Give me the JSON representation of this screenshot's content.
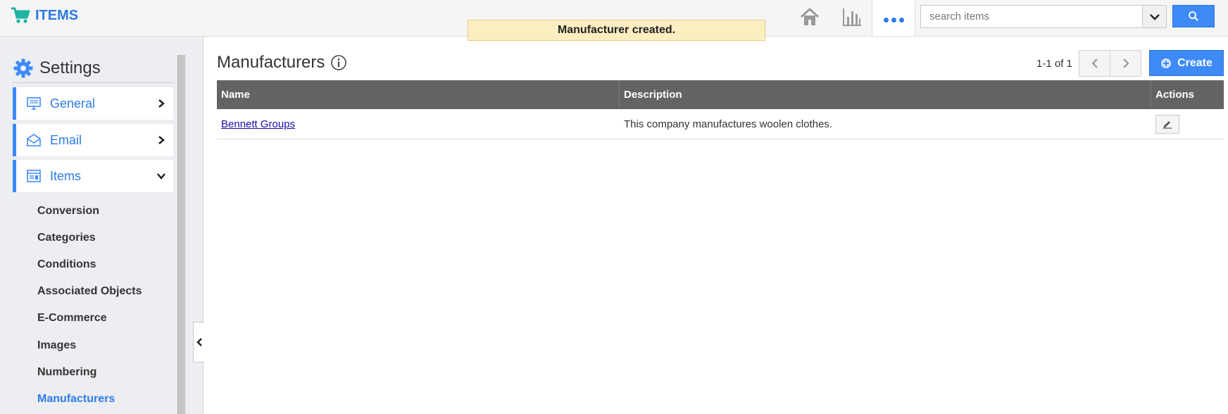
{
  "app": {
    "title": "ITEMS"
  },
  "toast": {
    "message": "Manufacturer created."
  },
  "header": {
    "icons": [
      "home-icon",
      "bar-chart-icon",
      "more-dots-icon"
    ],
    "search": {
      "placeholder": "search items",
      "value": ""
    }
  },
  "sidebar": {
    "heading": "Settings",
    "menus": [
      {
        "label": "General",
        "icon": "monitor-icon",
        "expanded": false
      },
      {
        "label": "Email",
        "icon": "envelope-icon",
        "expanded": false
      },
      {
        "label": "Items",
        "icon": "items-window-icon",
        "expanded": true
      }
    ],
    "sub_items": [
      {
        "label": "Conversion",
        "active": false
      },
      {
        "label": "Categories",
        "active": false
      },
      {
        "label": "Conditions",
        "active": false
      },
      {
        "label": "Associated Objects",
        "active": false
      },
      {
        "label": "E-Commerce",
        "active": false
      },
      {
        "label": "Images",
        "active": false
      },
      {
        "label": "Numbering",
        "active": false
      },
      {
        "label": "Manufacturers",
        "active": true
      }
    ]
  },
  "main": {
    "title": "Manufacturers",
    "pager": {
      "text": "1-1 of 1"
    },
    "create_label": "Create",
    "table": {
      "columns": [
        "Name",
        "Description",
        "Actions"
      ],
      "rows": [
        {
          "name": "Bennett Groups",
          "description": "This company manufactures woolen clothes."
        }
      ]
    }
  },
  "colors": {
    "accent": "#3d8af7",
    "brand": "#2c7be5",
    "toast_bg": "#fbeec1",
    "table_header": "#636363"
  }
}
